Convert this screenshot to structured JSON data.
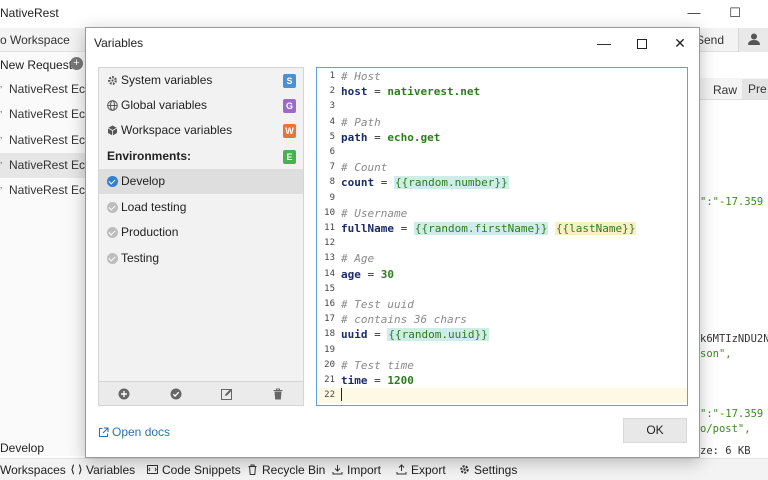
{
  "app": {
    "title": "NativeRest",
    "workspace": "o Workspace",
    "send_label": "Send",
    "new_request": "New Request",
    "requests": [
      {
        "label": "NativeRest Echo",
        "active": false
      },
      {
        "label": "NativeRest Echo",
        "active": false
      },
      {
        "label": "NativeRest Echo",
        "active": false
      },
      {
        "label": "NativeRest Echo",
        "active": true
      },
      {
        "label": "NativeRest Echo",
        "active": false
      }
    ],
    "response_tabs": {
      "raw": "Raw",
      "preview": "Pre"
    },
    "response_lines": [
      "\":\"-17.359",
      "k6MTIzNDU2N",
      "son\",",
      "\":\"-17.359",
      "o/post\",",
      "ze: 6 KB"
    ],
    "status_env": "Develop",
    "bottom_bar": [
      {
        "label": "Workspaces",
        "icon": "workspaces-icon"
      },
      {
        "label": "Variables",
        "icon": "variables-icon"
      },
      {
        "label": "Code Snippets",
        "icon": "code-icon"
      },
      {
        "label": "Recycle Bin",
        "icon": "trash-icon"
      },
      {
        "label": "Import",
        "icon": "import-icon"
      },
      {
        "label": "Export",
        "icon": "export-icon"
      },
      {
        "label": "Settings",
        "icon": "gear-icon"
      }
    ]
  },
  "dialog": {
    "title": "Variables",
    "scopes": [
      {
        "label": "System variables",
        "badge": "S",
        "badge_color": "#4a90d9",
        "icon": "gear-icon"
      },
      {
        "label": "Global variables",
        "badge": "G",
        "badge_color": "#9b6bc9",
        "icon": "globe-icon"
      },
      {
        "label": "Workspace variables",
        "badge": "W",
        "badge_color": "#e8743b",
        "icon": "cube-icon"
      }
    ],
    "environments_header": "Environments:",
    "environments_badge": "E",
    "environments_badge_color": "#4caf50",
    "environments": [
      {
        "label": "Develop",
        "selected": true,
        "color": "#2f7fd6"
      },
      {
        "label": "Load testing",
        "selected": false,
        "color": "#bdbdbd"
      },
      {
        "label": "Production",
        "selected": false,
        "color": "#bdbdbd"
      },
      {
        "label": "Testing",
        "selected": false,
        "color": "#bdbdbd"
      }
    ],
    "editor_lines": [
      {
        "n": "1",
        "parts": [
          {
            "t": "cm",
            "v": "# Host"
          }
        ]
      },
      {
        "n": "2",
        "parts": [
          {
            "t": "kw",
            "v": "host"
          },
          {
            "t": "op",
            "v": " = "
          },
          {
            "t": "str",
            "v": "nativerest.net"
          }
        ]
      },
      {
        "n": "3",
        "parts": []
      },
      {
        "n": "4",
        "parts": [
          {
            "t": "cm",
            "v": "# Path"
          }
        ]
      },
      {
        "n": "5",
        "parts": [
          {
            "t": "kw",
            "v": "path"
          },
          {
            "t": "op",
            "v": " = "
          },
          {
            "t": "str",
            "v": "echo.get"
          }
        ]
      },
      {
        "n": "6",
        "parts": []
      },
      {
        "n": "7",
        "parts": [
          {
            "t": "cm",
            "v": "# Count"
          }
        ]
      },
      {
        "n": "8",
        "parts": [
          {
            "t": "kw",
            "v": "count"
          },
          {
            "t": "op",
            "v": " = "
          },
          {
            "t": "var",
            "v": "{{random.number}}"
          }
        ]
      },
      {
        "n": "9",
        "parts": []
      },
      {
        "n": "10",
        "parts": [
          {
            "t": "cm",
            "v": "# Username"
          }
        ]
      },
      {
        "n": "11",
        "parts": [
          {
            "t": "kw",
            "v": "fullName"
          },
          {
            "t": "op",
            "v": " = "
          },
          {
            "t": "var",
            "v": "{{random.firstName}}"
          },
          {
            "t": "op",
            "v": " "
          },
          {
            "t": "var yellow",
            "v": "{{lastName}}"
          }
        ]
      },
      {
        "n": "12",
        "parts": []
      },
      {
        "n": "13",
        "parts": [
          {
            "t": "cm",
            "v": "# Age"
          }
        ]
      },
      {
        "n": "14",
        "parts": [
          {
            "t": "kw",
            "v": "age"
          },
          {
            "t": "op",
            "v": " = "
          },
          {
            "t": "num",
            "v": "30"
          }
        ]
      },
      {
        "n": "15",
        "parts": []
      },
      {
        "n": "16",
        "parts": [
          {
            "t": "cm",
            "v": "# Test uuid"
          }
        ]
      },
      {
        "n": "17",
        "parts": [
          {
            "t": "cm",
            "v": "# contains 36 chars"
          }
        ]
      },
      {
        "n": "18",
        "parts": [
          {
            "t": "kw",
            "v": "uuid"
          },
          {
            "t": "op",
            "v": " = "
          },
          {
            "t": "var",
            "v": "{{random.uuid}}"
          }
        ]
      },
      {
        "n": "19",
        "parts": []
      },
      {
        "n": "20",
        "parts": [
          {
            "t": "cm",
            "v": "# Test time"
          }
        ]
      },
      {
        "n": "21",
        "parts": [
          {
            "t": "kw",
            "v": "time"
          },
          {
            "t": "op",
            "v": " = "
          },
          {
            "t": "num",
            "v": "1200"
          }
        ]
      },
      {
        "n": "22",
        "parts": [],
        "current": true
      }
    ],
    "open_docs": "Open docs",
    "ok_label": "OK"
  }
}
